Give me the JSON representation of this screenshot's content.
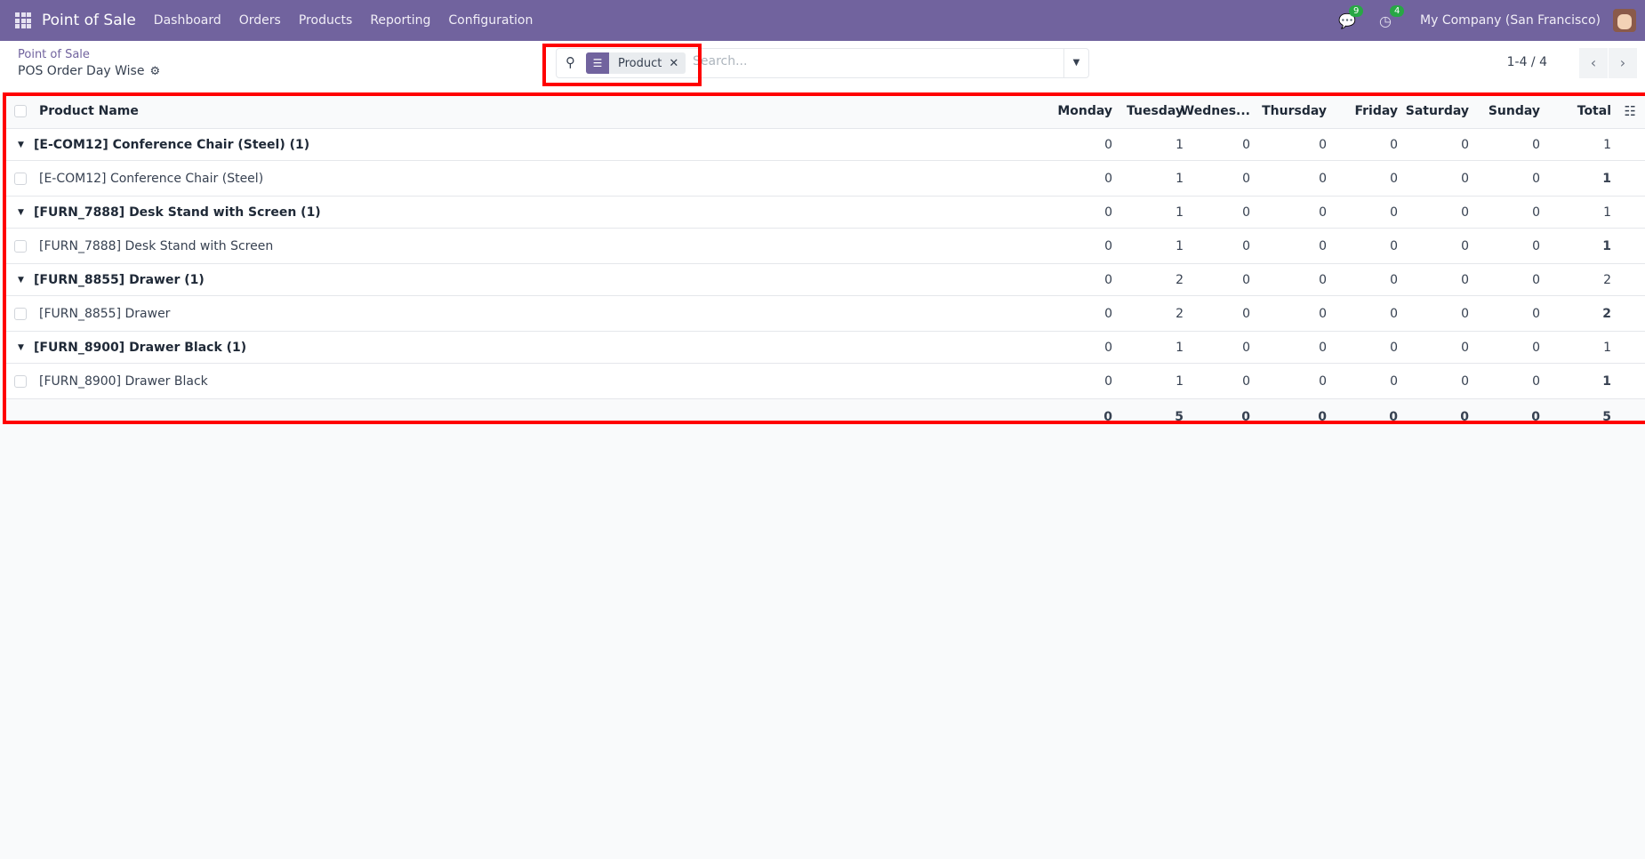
{
  "navbar": {
    "app_title": "Point of Sale",
    "menu": [
      "Dashboard",
      "Orders",
      "Products",
      "Reporting",
      "Configuration"
    ],
    "messages_count": "9",
    "activities_count": "4",
    "company": "My Company (San Francisco)"
  },
  "breadcrumb": {
    "parent": "Point of Sale",
    "current": "POS Order Day Wise"
  },
  "search": {
    "facet_label": "Product",
    "placeholder": "Search..."
  },
  "pager": {
    "text": "1-4 / 4"
  },
  "table": {
    "columns": [
      "Product Name",
      "Monday",
      "Tuesday",
      "Wednes...",
      "Thursday",
      "Friday",
      "Saturday",
      "Sunday",
      "Total"
    ],
    "groups": [
      {
        "label": "[E-COM12] Conference Chair (Steel) (1)",
        "values": [
          "0",
          "1",
          "0",
          "0",
          "0",
          "0",
          "0",
          "1"
        ],
        "records": [
          {
            "name": "[E-COM12] Conference Chair (Steel)",
            "values": [
              "0",
              "1",
              "0",
              "0",
              "0",
              "0",
              "0",
              "1"
            ]
          }
        ]
      },
      {
        "label": "[FURN_7888] Desk Stand with Screen (1)",
        "values": [
          "0",
          "1",
          "0",
          "0",
          "0",
          "0",
          "0",
          "1"
        ],
        "records": [
          {
            "name": "[FURN_7888] Desk Stand with Screen",
            "values": [
              "0",
              "1",
              "0",
              "0",
              "0",
              "0",
              "0",
              "1"
            ]
          }
        ]
      },
      {
        "label": "[FURN_8855] Drawer (1)",
        "values": [
          "0",
          "2",
          "0",
          "0",
          "0",
          "0",
          "0",
          "2"
        ],
        "records": [
          {
            "name": "[FURN_8855] Drawer",
            "values": [
              "0",
              "2",
              "0",
              "0",
              "0",
              "0",
              "0",
              "2"
            ]
          }
        ]
      },
      {
        "label": "[FURN_8900] Drawer Black (1)",
        "values": [
          "0",
          "1",
          "0",
          "0",
          "0",
          "0",
          "0",
          "1"
        ],
        "records": [
          {
            "name": "[FURN_8900] Drawer Black",
            "values": [
              "0",
              "1",
              "0",
              "0",
              "0",
              "0",
              "0",
              "1"
            ]
          }
        ]
      }
    ],
    "totals": [
      "0",
      "5",
      "0",
      "0",
      "0",
      "0",
      "0",
      "5"
    ]
  },
  "colors": {
    "brand": "#71639e",
    "highlight": "#ff0000",
    "badge": "#28a745"
  }
}
